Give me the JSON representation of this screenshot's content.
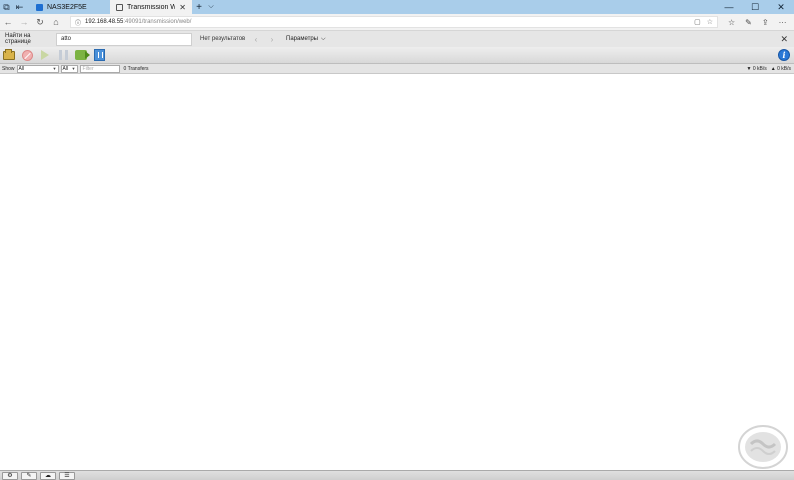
{
  "browser": {
    "tabs": [
      {
        "title": "NAS3E2F5E",
        "active": false
      },
      {
        "title": "Transmission Web Interf",
        "active": true
      }
    ],
    "address": {
      "host": "192.168.48.55",
      "rest": ":49091/transmission/web/"
    }
  },
  "find": {
    "label": "Найти на странице",
    "query": "atto",
    "result": "Нет результатов",
    "options_label": "Параметры"
  },
  "filter": {
    "show_label": "Show",
    "state_select": "All",
    "tracker_select": "All",
    "filter_placeholder": "Filter",
    "count": "0 Transfers",
    "download_speed": "0 kB/s",
    "upload_speed": "0 kB/s"
  },
  "colors": {
    "tabstrip": "#a9cdea",
    "accent": "#2a78d6"
  }
}
